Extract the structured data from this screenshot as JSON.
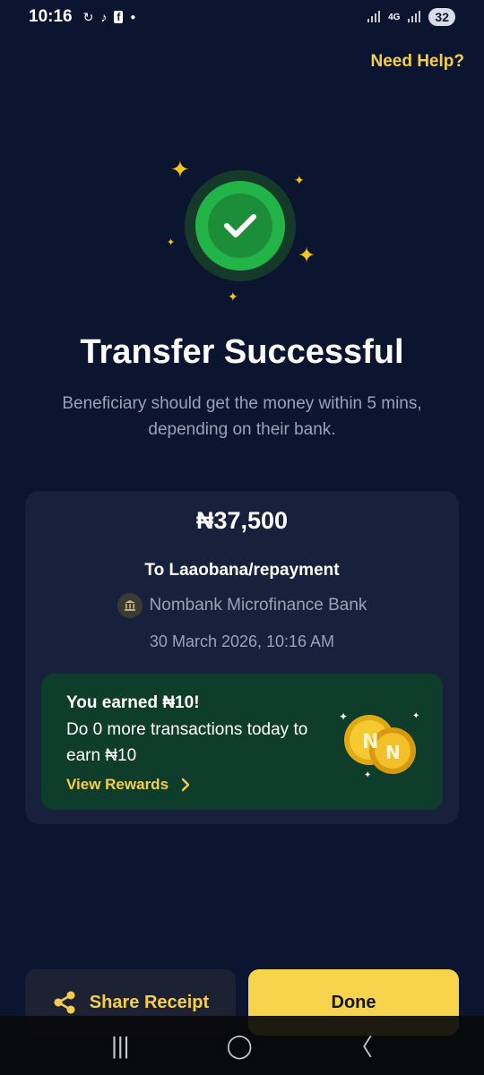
{
  "status_bar": {
    "time": "10:16",
    "network": "4G",
    "battery": "32"
  },
  "header": {
    "help_link": "Need Help?"
  },
  "result": {
    "title": "Transfer Successful",
    "subtitle": "Beneficiary should get the money within 5 mins, depending on their bank."
  },
  "receipt": {
    "amount": "₦37,500",
    "recipient": "To Laaobana/repayment",
    "bank_name": "Nombank Microfinance Bank",
    "date": "30 March 2026, 10:16 AM"
  },
  "reward": {
    "title": "You earned ₦10!",
    "description": "Do 0 more transactions today to earn ₦10",
    "link_label": "View Rewards"
  },
  "actions": {
    "share_label": "Share Receipt",
    "done_label": "Done"
  },
  "colors": {
    "background": "#0b1530",
    "accent": "#f7d44c",
    "success": "#22b447",
    "reward_bg": "#0f3d2c"
  },
  "icons": {
    "success": "check-circle-icon",
    "bank": "bank-icon",
    "share": "share-icon",
    "chevron": "chevron-right-icon",
    "coins": "coins-icon"
  }
}
